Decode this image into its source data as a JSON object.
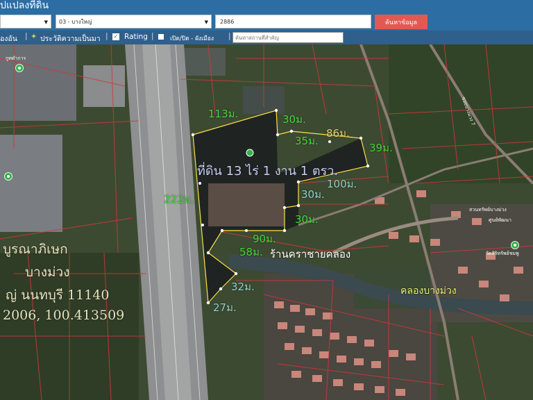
{
  "header": {
    "title": "ปแปลงที่ดิน",
    "district_select": "03 - บางใหญ่",
    "parcel_value": "2886",
    "search_label": "ค้นหาข้อมูล"
  },
  "toolbar": {
    "item1": "องอัน",
    "item2": "ประวัติความเป็นมา",
    "item3": "Rating",
    "item4": "เปิด/ปิด - ผังเมือง",
    "search_placeholder": "ค้นหาสถานที่สำคัญ"
  },
  "map": {
    "area_label": "ที่ดิน 13 ไร่ 1 งาน 1 ตรว.",
    "measurements": {
      "m113": "113ม.",
      "m30a": "30ม.",
      "m86": "86ม.",
      "m35": "35ม.",
      "m39": "39ม.",
      "m100": "100ม.",
      "m30b": "30ม.",
      "m30c": "30ม.",
      "m222": "222ม.",
      "m90": "90ม.",
      "m58": "58ม.",
      "m32": "32ม.",
      "m27": "27ม."
    },
    "shop_label": "ร้านคราชายคลอง",
    "canal_label": "คลองบางม่วง",
    "address_lines": [
      "บูรณาภิเษก",
      "บางม่วง",
      "ญ่ นนทบุรี 11140",
      "2006, 100.413509"
    ],
    "poi_top_left": "กูทดำการ",
    "poi_right": "สวนทรัพย์บางม่วง",
    "poi_right2": "วัดสิริทรัพย์ชมพู",
    "poi_right3": "ศูนย์พัฒนา",
    "road_text": "ซอยบางม่วง 7",
    "colors": {
      "parcel_outline": "#ffe14a",
      "parcel_lines": "#d23838",
      "header_bg": "#2c6da3",
      "search_bg": "#e05a52"
    }
  }
}
